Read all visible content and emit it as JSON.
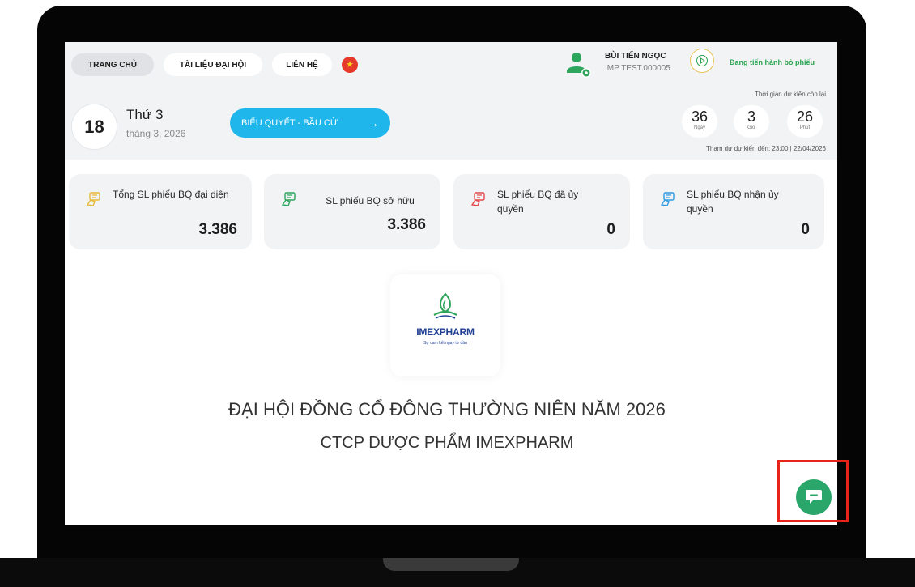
{
  "nav": {
    "home": "TRANG CHỦ",
    "documents": "TÀI LIỆU ĐẠI HỘI",
    "contact": "LIÊN HỆ",
    "language_flag": "vietnam-flag-icon"
  },
  "user": {
    "name": "BÙI TIẾN NGỌC",
    "code": "IMP TEST.000005",
    "voting_status": "Đang tiến hành bỏ phiếu"
  },
  "date": {
    "day": "18",
    "weekday": "Thứ 3",
    "month_year": "tháng 3, 2026"
  },
  "vote_button": {
    "label": "BIỂU QUYẾT - BẦU CỬ",
    "arrow": "→"
  },
  "countdown": {
    "title": "Thời gian dự kiến còn lại",
    "days": "36",
    "days_unit": "Ngày",
    "hours": "3",
    "hours_unit": "Giờ",
    "minutes": "26",
    "minutes_unit": "Phút",
    "deadline": "Tham dự dự kiến đến: 23:00 | 22/04/2026"
  },
  "stats": [
    {
      "label": "Tổng SL phiếu BQ đại diện",
      "value": "3.386",
      "icon_color": "#e8b93a"
    },
    {
      "label": "SL phiếu BQ sở hữu",
      "value": "3.386",
      "icon_color": "#2ea55c"
    },
    {
      "label": "SL phiếu BQ đã ủy quyền",
      "value": "0",
      "icon_color": "#e5484d"
    },
    {
      "label": "SL phiếu BQ nhận ủy quyền",
      "value": "0",
      "icon_color": "#2f9be0"
    }
  ],
  "logo": {
    "name": "IMEXPHARM",
    "tagline": "Sự cam kết ngay từ đầu"
  },
  "event": {
    "title": "ĐẠI HỘI ĐỒNG CỔ ĐÔNG THƯỜNG NIÊN NĂM 2026",
    "company": "CTCP DƯỢC PHẨM IMEXPHARM"
  },
  "colors": {
    "accent_blue": "#1fb6ec",
    "status_green": "#27a34e",
    "chat_green": "#2aa66a",
    "highlight_red": "#e8231a"
  }
}
